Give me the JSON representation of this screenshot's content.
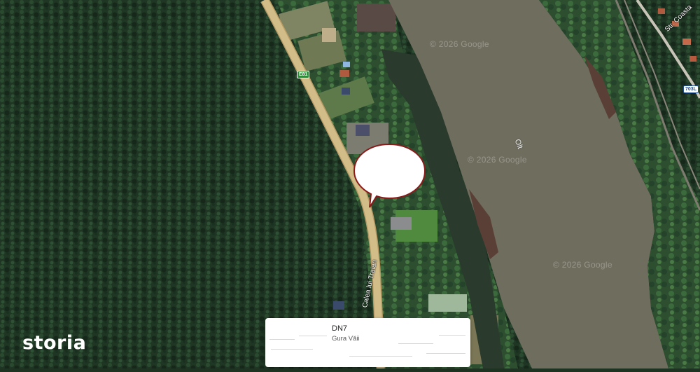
{
  "map": {
    "watermarks": [
      "© 2026 Google",
      "© 2026 Google",
      "© 2026 Google"
    ],
    "river_name": "Olt",
    "street_names": [
      "Calea lui Traian",
      "Str. Coasta"
    ],
    "road_shields": [
      "E81",
      "703L"
    ]
  },
  "branding": {
    "logo_text": "storia"
  },
  "location_card": {
    "title": "DN7",
    "subtitle": "Gura Văii"
  },
  "colors": {
    "forest": "#1e3322",
    "river": "#6f6d5e",
    "road": "#c9b27a",
    "marker_outline": "#8b1a1a",
    "card_bg": "#ffffff"
  }
}
